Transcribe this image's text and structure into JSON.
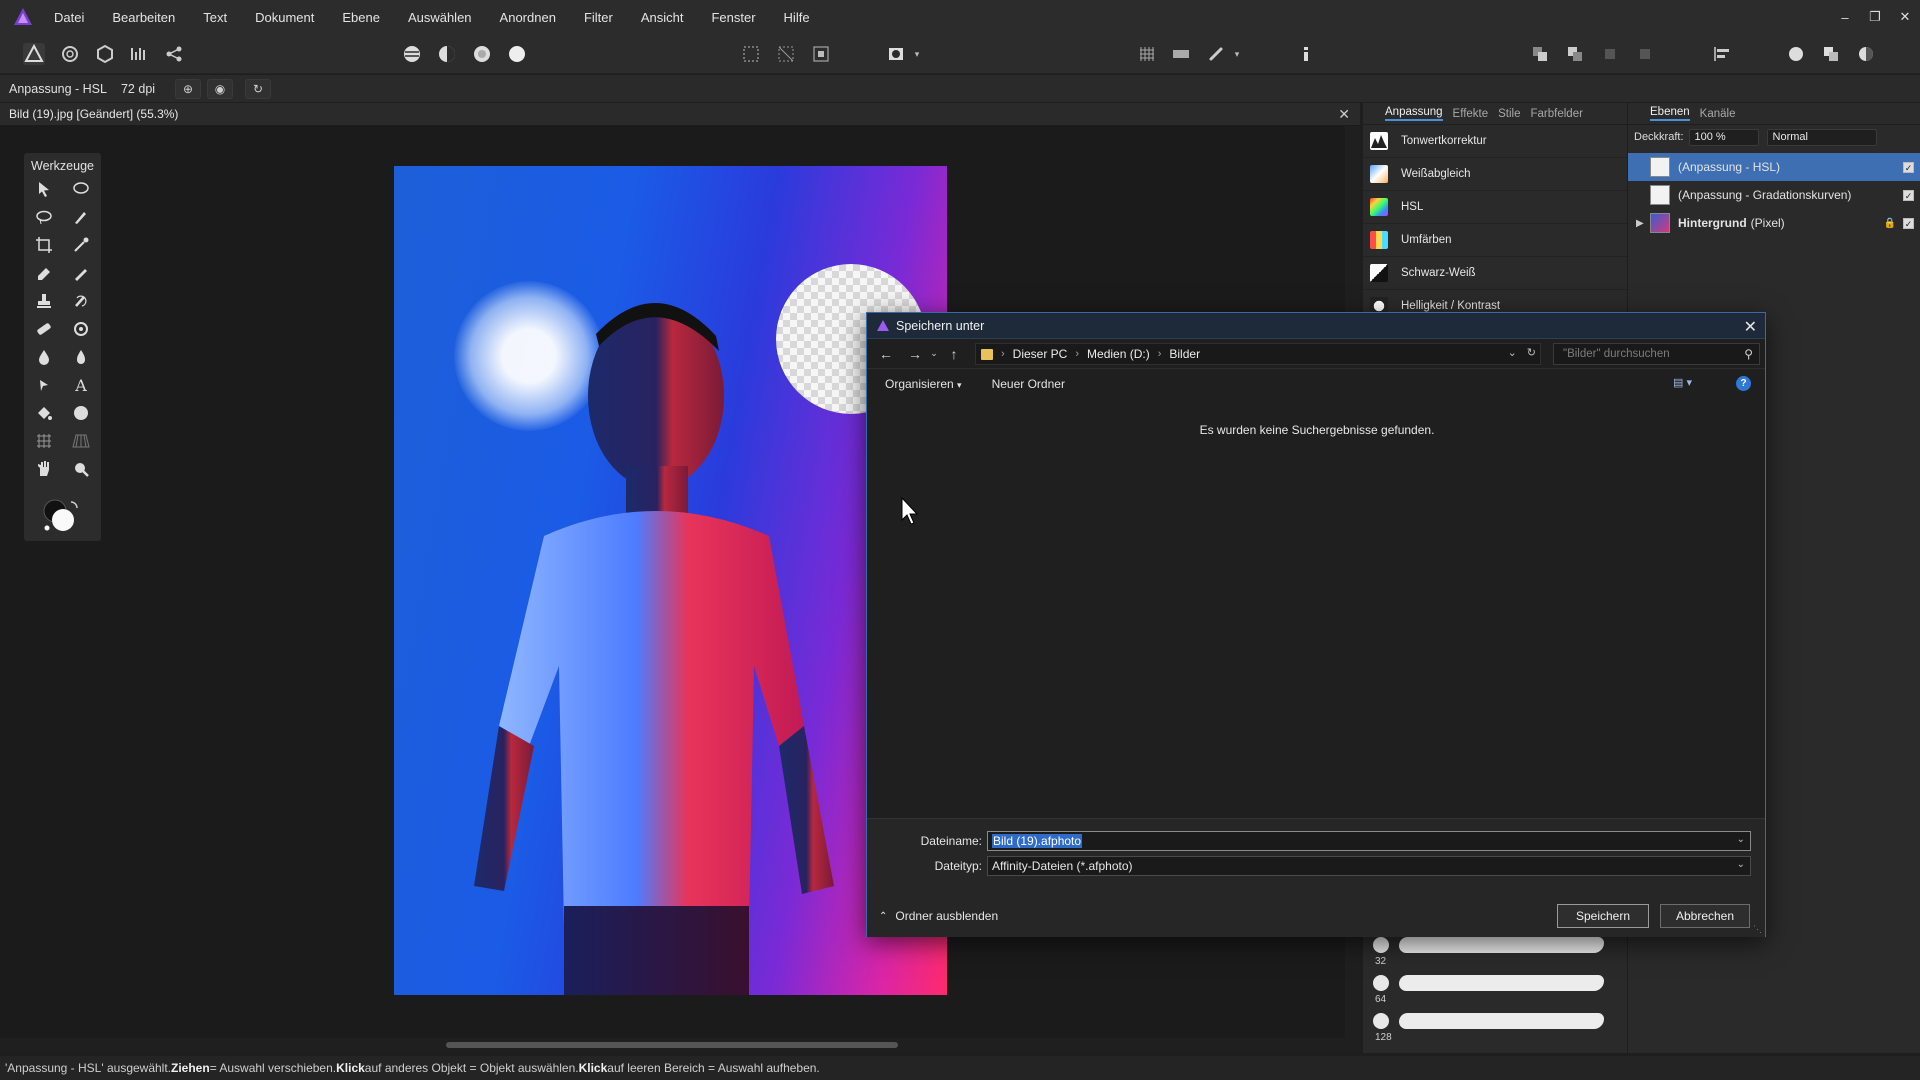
{
  "menubar": {
    "items": [
      "Datei",
      "Bearbeiten",
      "Text",
      "Dokument",
      "Ebene",
      "Auswählen",
      "Anordnen",
      "Filter",
      "Ansicht",
      "Fenster",
      "Hilfe"
    ]
  },
  "contextbar": {
    "layer_label": "Anpassung - HSL",
    "dpi": "72 dpi"
  },
  "document": {
    "tab_title": "Bild (19).jpg [Geändert] (55.3%)"
  },
  "tools": {
    "title": "Werkzeuge"
  },
  "adjustment_panel": {
    "tabs": [
      "Anpassung",
      "Effekte",
      "Stile",
      "Farbfelder"
    ],
    "items": [
      "Tonwertkorrektur",
      "Weißabgleich",
      "HSL",
      "Umfärben",
      "Schwarz-Weiß",
      "Helligkeit / Kontrast"
    ],
    "brush_sizes": [
      "32",
      "64",
      "128"
    ]
  },
  "layers_panel": {
    "tabs": [
      "Ebenen",
      "Kanäle"
    ],
    "opacity_label": "Deckkraft:",
    "opacity_value": "100 %",
    "blend_mode": "Normal",
    "layers": [
      {
        "name": "(Anpassung - HSL)",
        "suffix": ""
      },
      {
        "name": "(Anpassung - Gradationskurven)",
        "suffix": ""
      },
      {
        "name": "Hintergrund",
        "suffix": "(Pixel)"
      }
    ]
  },
  "dialog": {
    "title": "Speichern unter",
    "breadcrumb": [
      "Dieser PC",
      "Medien (D:)",
      "Bilder"
    ],
    "search_placeholder": "\"Bilder\" durchsuchen",
    "organize": "Organisieren",
    "new_folder": "Neuer Ordner",
    "empty_message": "Es wurden keine Suchergebnisse gefunden.",
    "filename_label": "Dateiname:",
    "filename_value": "Bild (19).afphoto",
    "filetype_label": "Dateityp:",
    "filetype_value": "Affinity-Dateien (*.afphoto)",
    "hide_folders": "Ordner ausblenden",
    "save_button": "Speichern",
    "cancel_button": "Abbrechen"
  },
  "statusbar": {
    "part1": "'Anpassung - HSL' ausgewählt. ",
    "drag": "Ziehen",
    "part2": " = Auswahl verschieben. ",
    "click1": "Klick",
    "part3": " auf anderes Objekt = Objekt auswählen. ",
    "click2": "Klick",
    "part4": " auf leeren Bereich = Auswahl aufheben."
  },
  "colors": {
    "accent": "#3f6fb3",
    "dialog_border": "#3b6aa6",
    "selection": "#2f6cc9"
  }
}
